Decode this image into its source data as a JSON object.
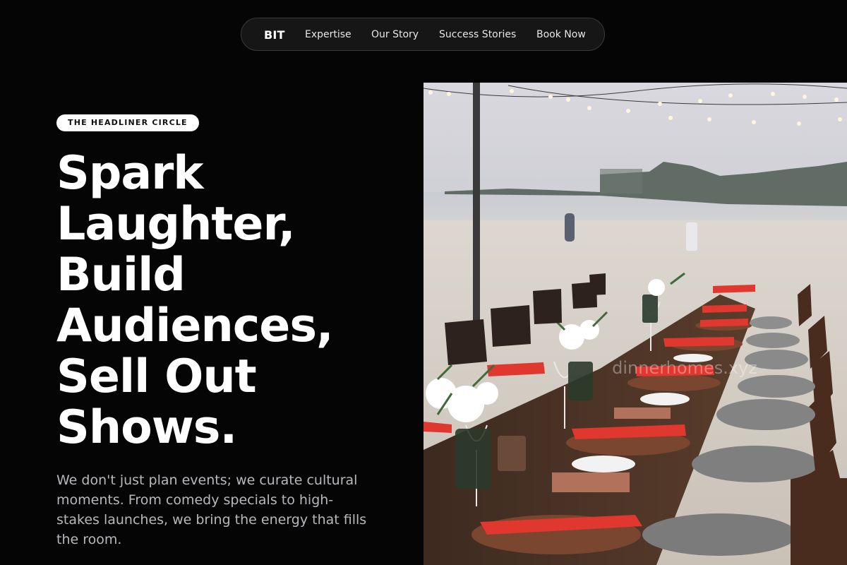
{
  "nav": {
    "brand": "BIT",
    "links": [
      "Expertise",
      "Our Story",
      "Success Stories",
      "Book Now"
    ]
  },
  "hero": {
    "badge": "THE HEADLINER CIRCLE",
    "headline_lines": [
      "Spark",
      "Laughter,",
      "Build",
      "Audiences,",
      "Sell Out",
      "Shows."
    ],
    "lead": "We don't just plan events; we curate cultural moments. From comedy specials to high-stakes launches, we bring the energy that fills the room."
  },
  "image": {
    "watermark": "dinnerhomes.xyz"
  },
  "colors": {
    "background": "#060506",
    "napkin_red": "#e0372f",
    "chair_wood": "#4a2c1e"
  }
}
